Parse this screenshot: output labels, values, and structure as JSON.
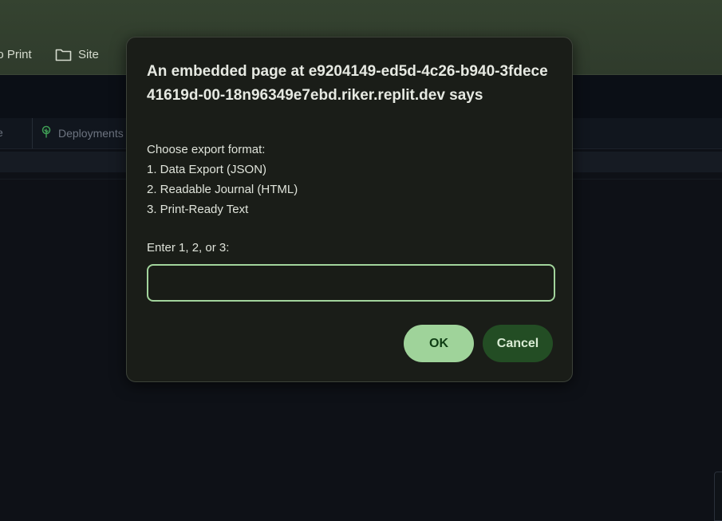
{
  "bookmarks": [
    {
      "label": "no Print"
    },
    {
      "label": "Site",
      "icon": "folder-icon"
    }
  ],
  "tabs": {
    "fragment_label": "e",
    "deployments_label": "Deployments",
    "deployments_icon": "tree-icon"
  },
  "dialog": {
    "title": "An embedded page at e9204149-ed5d-4c26-b940-3fdece41619d-00-18n96349e7ebd.riker.replit.dev says",
    "message_lines": [
      "Choose export format:",
      "1. Data Export (JSON)",
      "2. Readable Journal (HTML)",
      "3. Print-Ready Text"
    ],
    "prompt": "Enter 1, 2, or 3:",
    "input_value": "",
    "ok_label": "OK",
    "cancel_label": "Cancel"
  },
  "colors": {
    "accent": "#a2d49c",
    "ok_button": "#9fd39a",
    "cancel_button": "#234d24"
  }
}
